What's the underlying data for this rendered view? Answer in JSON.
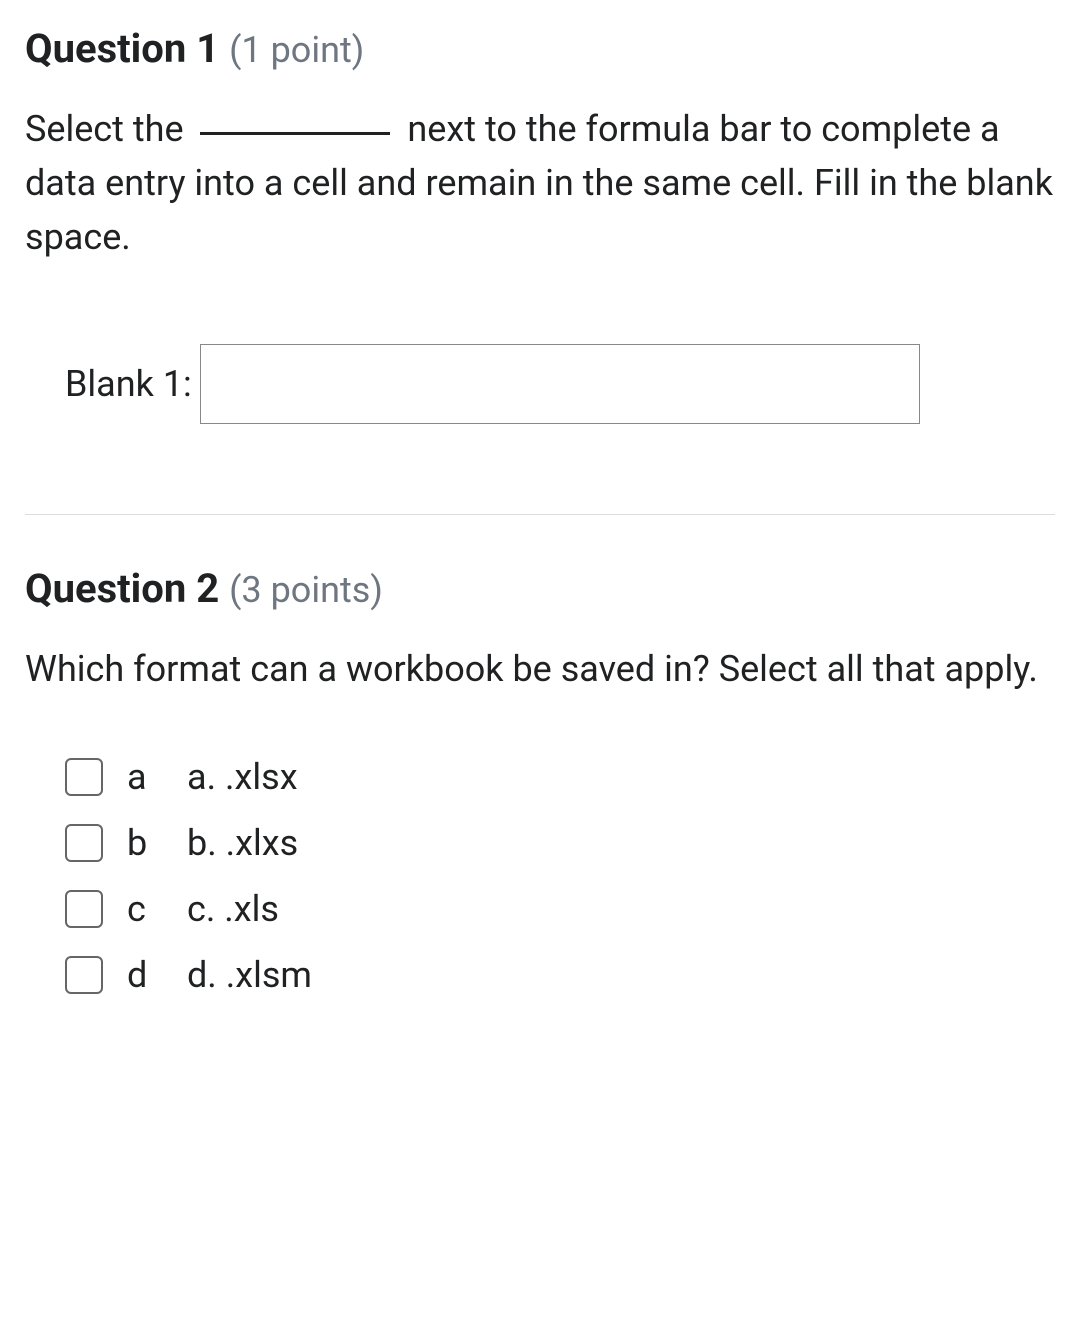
{
  "questions": [
    {
      "title": "Question 1",
      "points": "(1 point)",
      "prompt_before": "Select the ",
      "prompt_after": " next to the formula bar to complete a data entry into a cell and remain in the same cell. Fill in the blank space.",
      "blank_label": "Blank 1:",
      "blank_value": ""
    },
    {
      "title": "Question 2",
      "points": "(3 points)",
      "prompt": "Which format can a workbook be saved in? Select all that apply.",
      "options": [
        {
          "letter": "a",
          "text": "a. .xlsx"
        },
        {
          "letter": "b",
          "text": "b. .xlxs"
        },
        {
          "letter": "c",
          "text": "c. .xls"
        },
        {
          "letter": "d",
          "text": "d. .xlsm"
        }
      ]
    }
  ]
}
